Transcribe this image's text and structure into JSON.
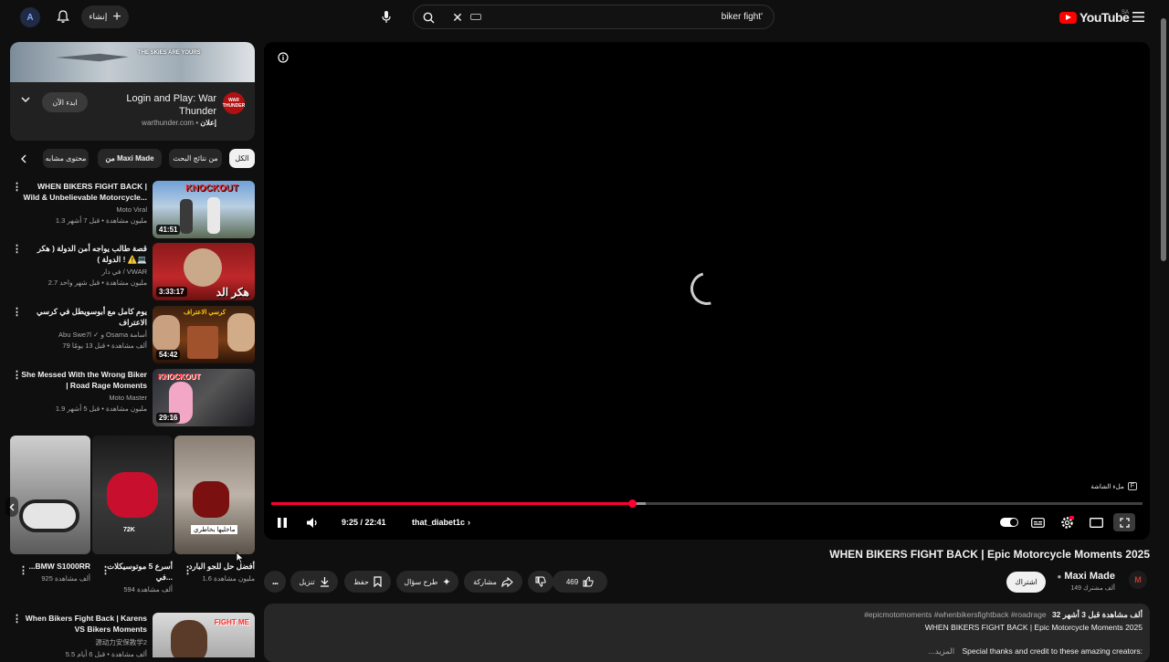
{
  "topbar": {
    "avatar_text": "A",
    "create_label": "إنشاء",
    "search_value": "biker fight'",
    "logo_text": "YouTube",
    "region": "SA"
  },
  "ad": {
    "title": "Login and Play: War Thunder",
    "sponsor": "إعلان",
    "domain": "warthunder.com",
    "cta": "ابدء الآن",
    "logo_text": "WAR THUNDER",
    "banner_text": "THE SKIES ARE YOURS"
  },
  "chips": [
    {
      "label": "الكل",
      "active": true
    },
    {
      "label": "من نتائج البحث",
      "active": false
    },
    {
      "label": "من Maxi Made",
      "active": false
    },
    {
      "label": "محتوى مشابه",
      "active": false
    }
  ],
  "sidebar_videos": [
    {
      "title": "WHEN BIKERS FIGHT BACK | Wild & Unbelievable Motorcycle...",
      "channel": "Moto Viral",
      "stats": "1.3 مليون مشاهدة • قبل 7 أشهر",
      "duration": "41:51",
      "thumb_text": "KNOCKOUT"
    },
    {
      "title": "قصة طالب يواجه أمن الدولة ( هكر الدولة ) ! ⚠️💻",
      "channel": "في دار / VWAR",
      "stats": "2.7 مليون مشاهدة • قبل شهر واحد",
      "duration": "3:33:17",
      "thumb_text": "هكر الد"
    },
    {
      "title": "يوم كامل مع أبوسويطل في كرسي الاعتراف",
      "channel": "Abu Swe7l ✓ و Osama أسامة",
      "stats": "79 ألف مشاهدة • قبل 13 يومًا",
      "duration": "54:42",
      "thumb_text": "كرسي الاعتراف"
    },
    {
      "title": "She Messed With the Wrong Biker | Road Rage Moments",
      "channel": "Moto Master",
      "stats": "1.9 مليون مشاهدة • قبل 5 أشهر",
      "duration": "29:16",
      "thumb_text": "KNOCKOUT"
    }
  ],
  "shorts": [
    {
      "title": "...BMW S1000RR",
      "views": "925 ألف مشاهدة",
      "overlay": ""
    },
    {
      "title": "أسرع 5 موتوسيكلات في...",
      "views": "594 ألف مشاهدة",
      "overlay": "72K"
    },
    {
      "title": "أفضل حل للجو البارد",
      "views": "1.6 مليون مشاهدة",
      "overlay": "ماخليها بخاطري"
    }
  ],
  "last_video": {
    "title": "When Bikers Fight Back | Karens VS Bikers Moments",
    "channel": "源动力安保教学2",
    "stats": "5.5 ألف مشاهدة • قبل 6 أيام",
    "thumb_text": "FIGHT ME"
  },
  "player": {
    "time": "9:25 / 22:41",
    "chapter": "that_diabet1c",
    "fullscreen_hint": "ملء الشاشة",
    "fullscreen_key": "F",
    "progress": 0.415,
    "buffered": 0.43,
    "info_icon": "info-icon"
  },
  "video": {
    "title": "WHEN BIKERS FIGHT BACK | Epic Motorcycle Moments 2025",
    "channel": "Maxi Made",
    "subscribers": "149 ألف مشترك",
    "subscribe_label": "اشتراك",
    "likes": "469",
    "share_label": "مشاركة",
    "ask_label": "طرح سؤال",
    "save_label": "حفظ",
    "download_label": "تنزيل",
    "more_label": "..."
  },
  "description": {
    "meta": "32 ألف مشاهدة  قبل 3 أشهر",
    "hashtags": "#epicmotomoments #whenbikersfightback #roadrage",
    "line1": "WHEN BIKERS FIGHT BACK | Epic Motorcycle Moments 2025",
    "line2": "Special thanks and credit to these amazing creators:",
    "more": "...المزيد"
  },
  "colors": {
    "accent": "#ff0033",
    "background": "#0f0f0f",
    "surface": "#272727"
  }
}
